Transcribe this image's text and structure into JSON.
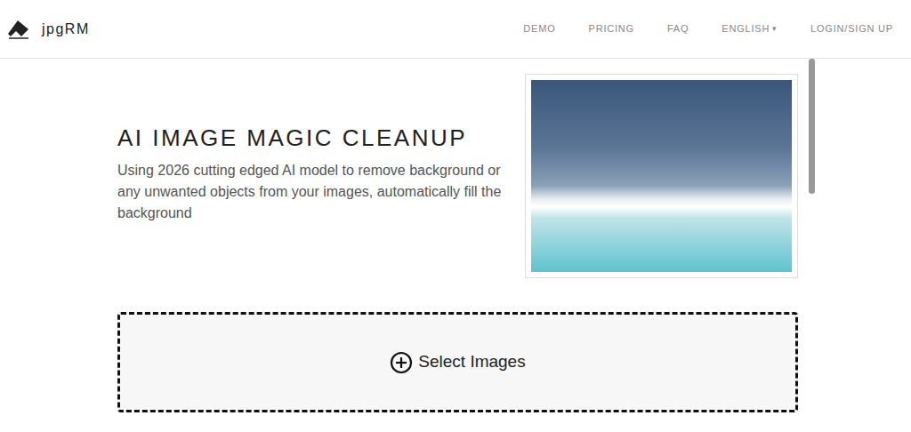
{
  "logo": {
    "text": "jpgRM"
  },
  "nav": [
    {
      "label": "DEMO"
    },
    {
      "label": "PRICING"
    },
    {
      "label": "FAQ"
    },
    {
      "label": "ENGLISH",
      "caret": "▾"
    },
    {
      "label": "LOGIN/SIGN UP"
    }
  ],
  "hero": {
    "title": "AI IMAGE MAGIC CLEANUP",
    "description": "Using 2026 cutting edged AI model to remove background or any unwanted objects from your images, automatically fill the background"
  },
  "upload": {
    "label": "Select Images"
  }
}
